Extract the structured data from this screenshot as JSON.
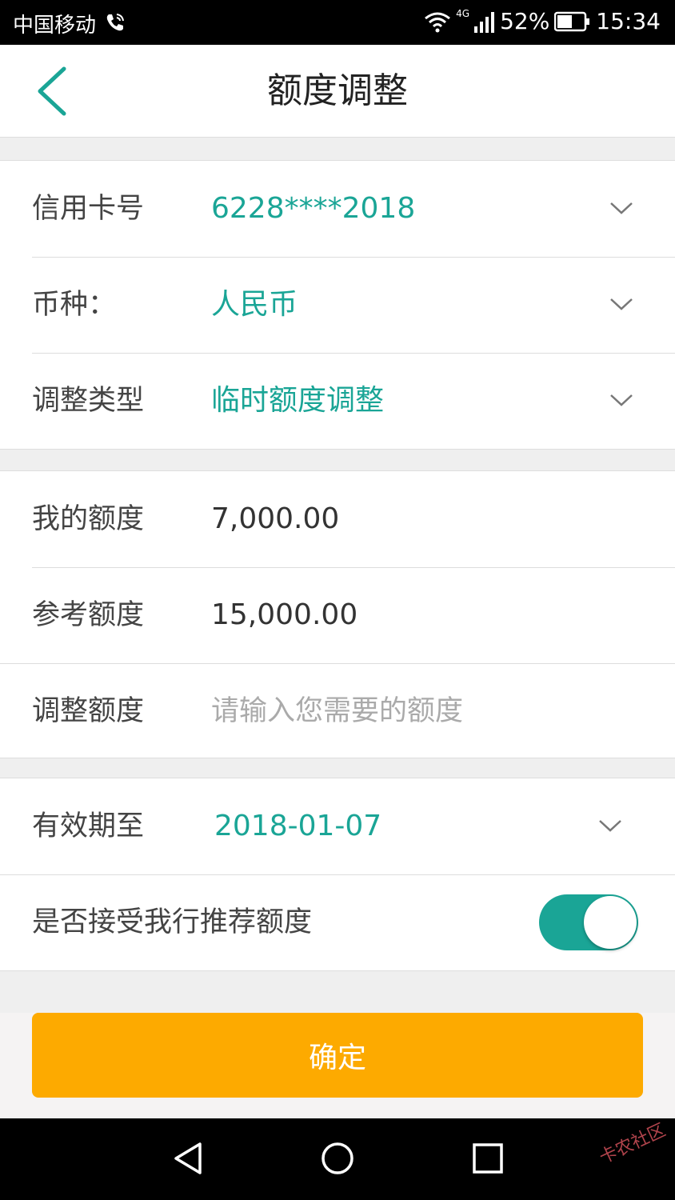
{
  "status_bar": {
    "carrier": "中国移动",
    "network": "4G",
    "battery": "52%",
    "time": "15:34"
  },
  "header": {
    "title": "额度调整"
  },
  "card_section": {
    "card_number_label": "信用卡号",
    "card_number_value": "6228****2018",
    "currency_label": "币种：",
    "currency_value": "人民币",
    "adjust_type_label": "调整类型",
    "adjust_type_value": "临时额度调整"
  },
  "amount_section": {
    "my_limit_label": "我的额度",
    "my_limit_value": "7,000.00",
    "reference_limit_label": "参考额度",
    "reference_limit_value": "15,000.00",
    "adjust_limit_label": "调整额度",
    "adjust_limit_placeholder": "请输入您需要的额度",
    "adjust_limit_value": ""
  },
  "option_section": {
    "valid_until_label": "有效期至",
    "valid_until_value": "2018-01-07",
    "accept_recommend_label": "是否接受我行推荐额度",
    "accept_recommend_on": true
  },
  "confirm_label": "确定",
  "watermark": "卡农社区",
  "colors": {
    "accent_teal": "#1aa596",
    "confirm_orange": "#fdaa00"
  }
}
